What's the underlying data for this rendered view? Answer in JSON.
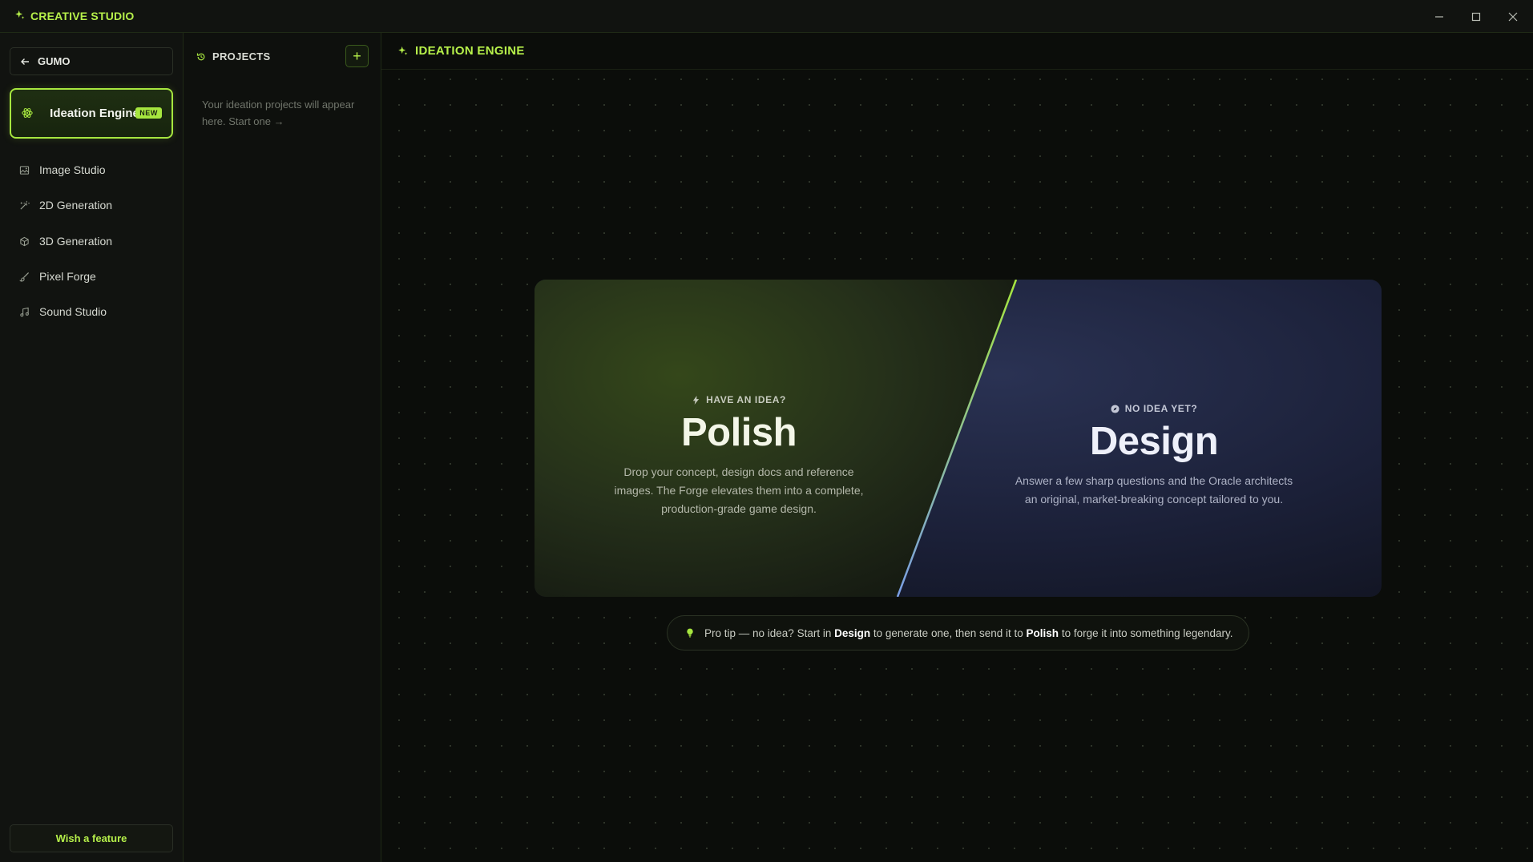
{
  "app": {
    "title": "CREATIVE STUDIO"
  },
  "sidebar": {
    "back_label": "GUMO",
    "active": {
      "label": "Ideation Engine",
      "badge": "NEW"
    },
    "items": [
      {
        "label": "Image Studio",
        "icon": "image-icon"
      },
      {
        "label": "2D Generation",
        "icon": "wand-icon"
      },
      {
        "label": "3D Generation",
        "icon": "cube-icon"
      },
      {
        "label": "Pixel Forge",
        "icon": "brush-icon"
      },
      {
        "label": "Sound Studio",
        "icon": "music-icon"
      }
    ],
    "wish_label": "Wish a feature"
  },
  "projects": {
    "title": "PROJECTS",
    "add_label": "+",
    "empty_text": "Your ideation projects will appear here. Start one →"
  },
  "main": {
    "title": "IDEATION ENGINE",
    "polish": {
      "eyebrow": "HAVE AN IDEA?",
      "title": "Polish",
      "description": "Drop your concept, design docs and reference images. The Forge elevates them into a complete, production-grade game design."
    },
    "design": {
      "eyebrow": "NO IDEA YET?",
      "title": "Design",
      "description": "Answer a few sharp questions and the Oracle architects an original, market-breaking concept tailored to you."
    },
    "tip": {
      "prefix": "Pro tip — no idea? Start in",
      "design_word": "Design",
      "middle": "to generate one, then send it to",
      "polish_word": "Polish",
      "suffix": "to forge it into something legendary."
    }
  },
  "colors": {
    "accent": "#a6e63f",
    "background": "#0b0d0a",
    "polish_panel": "#2c3a14",
    "design_panel": "#1e2540"
  }
}
